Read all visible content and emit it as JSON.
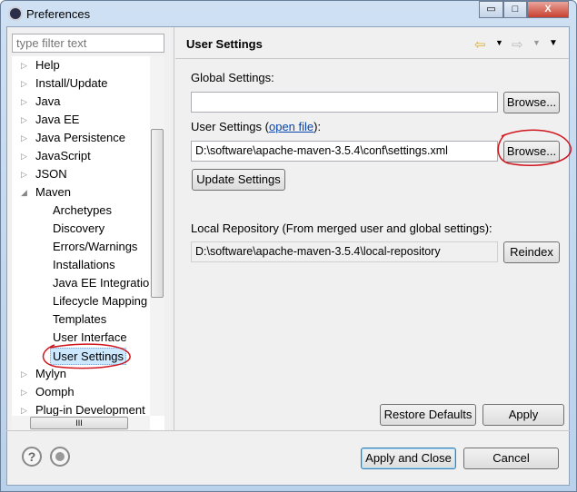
{
  "window": {
    "title": "Preferences",
    "minimize": "▭",
    "maximize": "□",
    "close": "X"
  },
  "sidebar": {
    "filter_placeholder": "type filter text",
    "items": [
      {
        "label": "Help",
        "level": 0,
        "expanded": false
      },
      {
        "label": "Install/Update",
        "level": 0,
        "expanded": false
      },
      {
        "label": "Java",
        "level": 0,
        "expanded": false
      },
      {
        "label": "Java EE",
        "level": 0,
        "expanded": false
      },
      {
        "label": "Java Persistence",
        "level": 0,
        "expanded": false
      },
      {
        "label": "JavaScript",
        "level": 0,
        "expanded": false
      },
      {
        "label": "JSON",
        "level": 0,
        "expanded": false
      },
      {
        "label": "Maven",
        "level": 0,
        "expanded": true
      },
      {
        "label": "Archetypes",
        "level": 1
      },
      {
        "label": "Discovery",
        "level": 1
      },
      {
        "label": "Errors/Warnings",
        "level": 1
      },
      {
        "label": "Installations",
        "level": 1
      },
      {
        "label": "Java EE Integration",
        "level": 1
      },
      {
        "label": "Lifecycle Mapping",
        "level": 1
      },
      {
        "label": "Templates",
        "level": 1
      },
      {
        "label": "User Interface",
        "level": 1
      },
      {
        "label": "User Settings",
        "level": 1,
        "selected": true
      },
      {
        "label": "Mylyn",
        "level": 0,
        "expanded": false
      },
      {
        "label": "Oomph",
        "level": 0,
        "expanded": false
      },
      {
        "label": "Plug-in Development",
        "level": 0,
        "expanded": false
      }
    ],
    "hscroll_grip": "III"
  },
  "page": {
    "title": "User Settings",
    "global_label": "Global Settings:",
    "global_value": "",
    "browse": "Browse...",
    "user_label_prefix": "User Settings (",
    "user_link": "open file",
    "user_label_suffix": "):",
    "user_value": "D:\\software\\apache-maven-3.5.4\\conf\\settings.xml",
    "update": "Update Settings",
    "local_label": "Local Repository (From merged user and global settings):",
    "local_value": "D:\\software\\apache-maven-3.5.4\\local-repository",
    "reindex": "Reindex",
    "restore": "Restore Defaults",
    "apply": "Apply"
  },
  "footer": {
    "help": "?",
    "apply_close": "Apply and Close",
    "cancel": "Cancel"
  },
  "colors": {
    "annotation": "#d0161e",
    "selection": "#cce8ff",
    "back_arrow": "#f0c020"
  }
}
